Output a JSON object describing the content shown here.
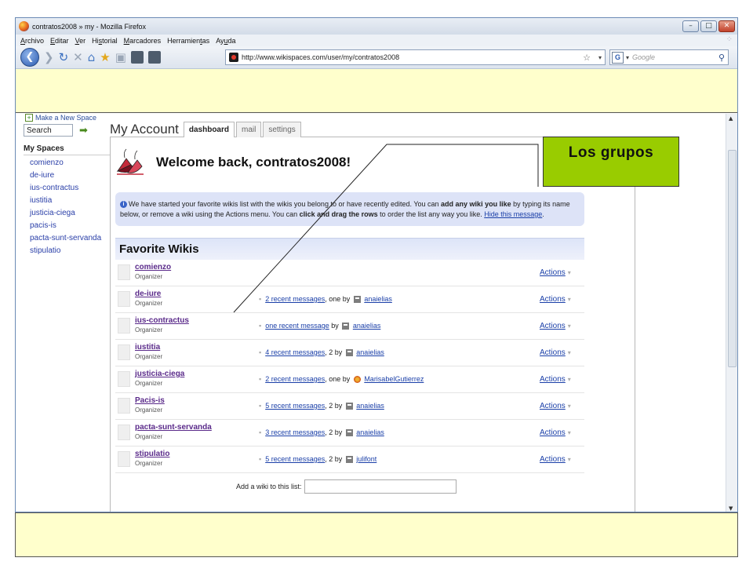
{
  "window": {
    "title": "contratos2008 » my - Mozilla Firefox"
  },
  "menu": {
    "items": [
      {
        "pre": "",
        "key": "A",
        "post": "rchivo"
      },
      {
        "pre": "",
        "key": "E",
        "post": "ditar"
      },
      {
        "pre": "",
        "key": "V",
        "post": "er"
      },
      {
        "pre": "Hi",
        "key": "s",
        "post": "torial"
      },
      {
        "pre": "",
        "key": "M",
        "post": "arcadores"
      },
      {
        "pre": "Herramien",
        "key": "t",
        "post": "as"
      },
      {
        "pre": "Ay",
        "key": "u",
        "post": "da"
      }
    ]
  },
  "navbar": {
    "url": "http://www.wikispaces.com/user/my/contratos2008",
    "search_placeholder": "Google"
  },
  "sidebar": {
    "new_space": "Make a New Space",
    "search_value": "Search",
    "my_spaces_heading": "My Spaces",
    "spaces": [
      "comienzo",
      "de-iure",
      "ius-contractus",
      "iustitia",
      "justicia-ciega",
      "pacis-is",
      "pacta-sunt-servanda",
      "stipulatio"
    ]
  },
  "account": {
    "title": "My Account",
    "tabs": [
      "dashboard",
      "mail",
      "settings"
    ],
    "welcome": "Welcome back, contratos2008!"
  },
  "info": {
    "t1": "We have started your favorite wikis list with the wikis you belong to or have recently edited. You can ",
    "b1": "add any wiki you like",
    "t2": " by typing its name below, or remove a wiki using the Actions menu. You can ",
    "b2": "click and drag the rows",
    "t3": " to order the list any way you like. ",
    "link": "Hide this message",
    "t4": "."
  },
  "favorites": {
    "heading": "Favorite Wikis",
    "actions_label": "Actions",
    "rows": [
      {
        "name": "comienzo",
        "role": "Organizer",
        "msg_link": "",
        "msg_mid": "",
        "user": "",
        "avatar": "none"
      },
      {
        "name": "de-iure",
        "role": "Organizer",
        "msg_link": "2 recent messages",
        "msg_mid": ", one by",
        "user": "anaielias",
        "avatar": "square"
      },
      {
        "name": "ius-contractus",
        "role": "Organizer",
        "msg_link": "one recent message",
        "msg_mid": " by",
        "user": "anaielias",
        "avatar": "square"
      },
      {
        "name": "iustitia",
        "role": "Organizer",
        "msg_link": "4 recent messages",
        "msg_mid": ", 2 by",
        "user": "anaielias",
        "avatar": "square"
      },
      {
        "name": "justicia-ciega",
        "role": "Organizer",
        "msg_link": "2 recent messages",
        "msg_mid": ", one by",
        "user": "MarisabelGutierrez",
        "avatar": "flower"
      },
      {
        "name": "Pacis-is",
        "role": "Organizer",
        "msg_link": "5 recent messages",
        "msg_mid": ", 2 by",
        "user": "anaielias",
        "avatar": "square"
      },
      {
        "name": "pacta-sunt-servanda",
        "role": "Organizer",
        "msg_link": "3 recent messages",
        "msg_mid": ", 2 by",
        "user": "anaielias",
        "avatar": "square"
      },
      {
        "name": "stipulatio",
        "role": "Organizer",
        "msg_link": "5 recent messages",
        "msg_mid": ", 2 by",
        "user": "julifont",
        "avatar": "square"
      }
    ],
    "add_label": "Add a wiki to this list:"
  },
  "callout": {
    "text": "Los grupos",
    "color": "#99cc00"
  }
}
